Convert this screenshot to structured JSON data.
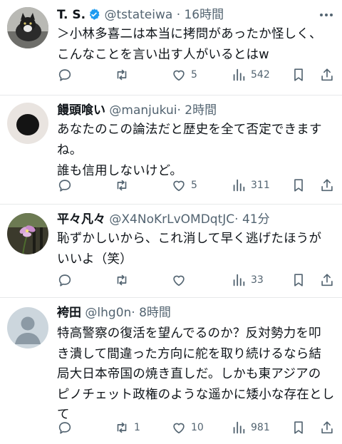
{
  "tweets": [
    {
      "name": "T. S.",
      "verified": true,
      "handle": "@tstateiwa",
      "time": "· 16時間",
      "text": "＞小林多喜二は本当に拷問があったか怪しく、\nこんなことを言い出す人がいるとはw",
      "replies": "",
      "retweets": "",
      "likes": "5",
      "views": "542",
      "avatar": "cat-photo"
    },
    {
      "name": "饅頭喰い",
      "verified": false,
      "handle": "@manjukui",
      "time": "· 2時間",
      "text": "あなたのこの論法だと歴史を全て否定できます\nね。\n誰も信用しないけど。",
      "replies": "",
      "retweets": "",
      "likes": "5",
      "views": "311",
      "avatar": "black-circle"
    },
    {
      "name": "平々凡々",
      "verified": false,
      "handle": "@X4NoKrLvOMDqtJC",
      "time": "· 41分",
      "text": "恥ずかしいから、これ消して早く逃げたほうが\nいいよ（笑）",
      "replies": "",
      "retweets": "",
      "likes": "",
      "views": "33",
      "avatar": "flower-photo"
    },
    {
      "name": "袴田",
      "verified": false,
      "handle": "@lhg0n",
      "time": "· 8時間",
      "text": "特高警察の復活を望んでるのか？反対勢力を叩\nき潰して間違った方向に舵を取り続けるなら結\n局大日本帝国の焼き直しだ。しかも東アジアの\nピノチェット政権のような遥かに矮小な存在とし\nて",
      "replies": "",
      "retweets": "1",
      "likes": "10",
      "views": "981",
      "avatar": "default-person"
    }
  ],
  "colors": {
    "accent": "#1d9bf0",
    "secondary_text": "#536471",
    "divider": "#e7e9ea"
  },
  "icons": [
    "more-icon",
    "verified-badge-icon",
    "reply-icon",
    "retweet-icon",
    "like-icon",
    "views-icon",
    "bookmark-icon",
    "share-icon"
  ]
}
